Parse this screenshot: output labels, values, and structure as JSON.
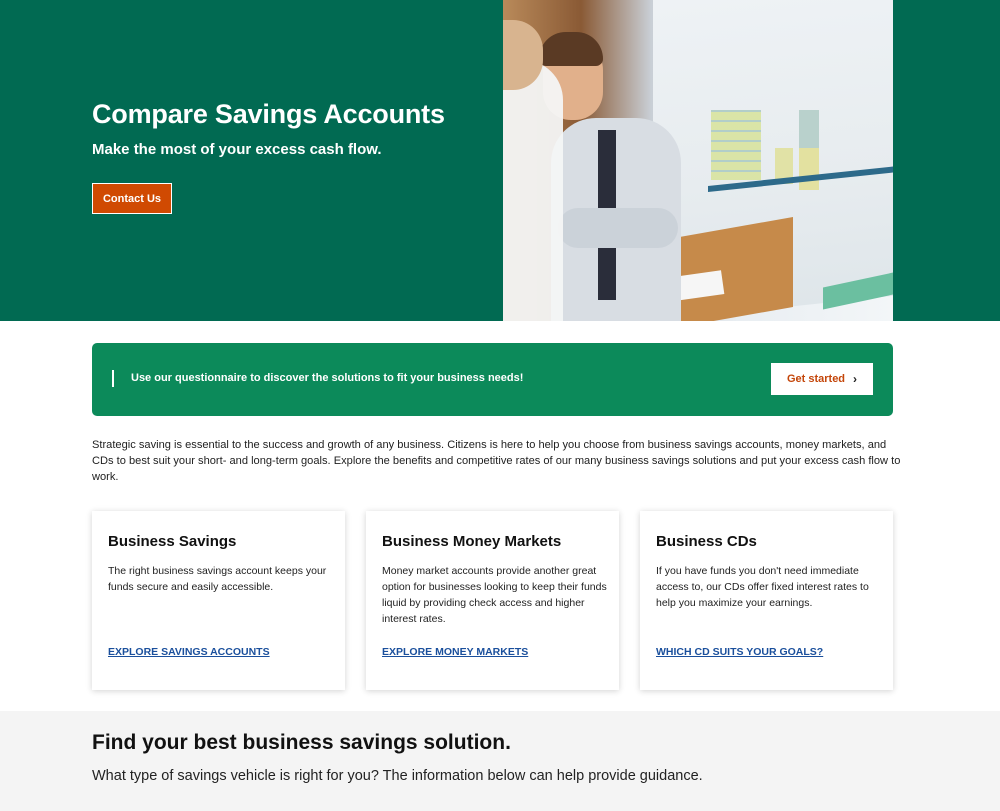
{
  "hero": {
    "title": "Compare Savings Accounts",
    "subtitle": "Make the most of your excess cash flow.",
    "cta_label": "Contact Us",
    "background_color": "#016a52",
    "cta_color": "#d04a02"
  },
  "banner": {
    "text": "Use our questionnaire to discover the solutions to fit your business needs!",
    "button_label": "Get started",
    "button_icon": "chevron-right-icon",
    "background_color": "#0c8a5a"
  },
  "intro": {
    "text": "Strategic saving is essential to the success and growth of any business. Citizens is here to help you choose from business savings accounts, money markets, and CDs to best suit your short- and long-term goals. Explore the benefits and competitive rates of our many business savings solutions and put your excess cash flow to work."
  },
  "cards": [
    {
      "title": "Business Savings",
      "body": "The right business savings account keeps your funds secure and easily accessible.",
      "link": "EXPLORE SAVINGS ACCOUNTS"
    },
    {
      "title": "Business Money Markets",
      "body": "Money market accounts provide another great option for businesses looking to keep their funds liquid by providing check access and higher interest rates.",
      "link": "EXPLORE MONEY MARKETS"
    },
    {
      "title": "Business CDs",
      "body": "If you have funds you don't need immediate access to, our CDs offer fixed interest rates to help you maximize your earnings.",
      "link": "WHICH CD SUITS YOUR GOALS?"
    }
  ],
  "bottom": {
    "title": "Find your best business savings solution.",
    "subtitle": "What type of savings vehicle is right for you? The information below can help provide guidance."
  }
}
